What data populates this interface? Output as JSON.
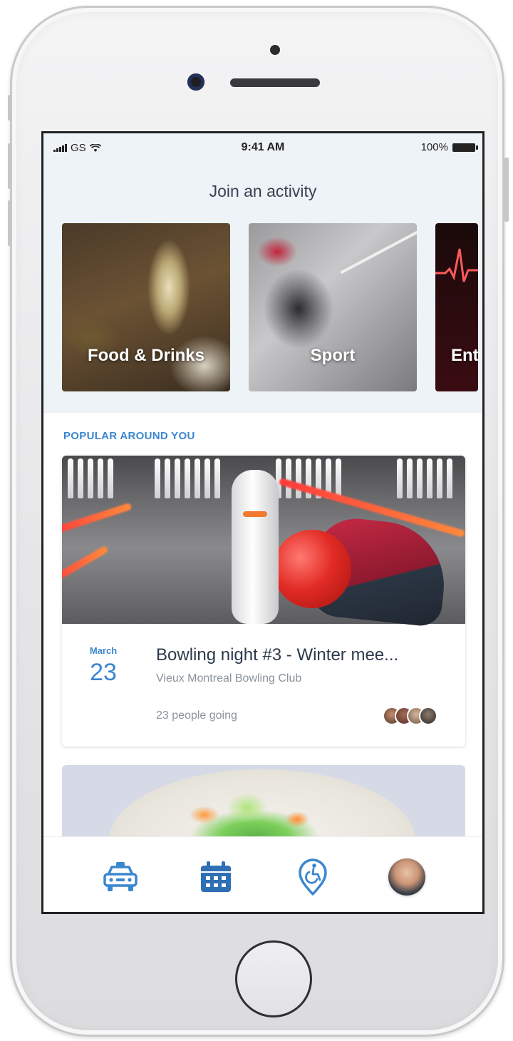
{
  "status_bar": {
    "carrier": "GS",
    "time": "9:41 AM",
    "battery": "100%"
  },
  "header": {
    "title": "Join an activity"
  },
  "categories": [
    {
      "label": "Food & Drinks"
    },
    {
      "label": "Sport"
    },
    {
      "label": "Ent"
    }
  ],
  "popular": {
    "section_title": "POPULAR AROUND YOU",
    "event": {
      "month": "March",
      "day": "23",
      "title": "Bowling night #3 - Winter mee...",
      "venue": "Vieux Montreal Bowling Club",
      "going": "23 people going"
    }
  },
  "tab_bar": {
    "items": [
      {
        "icon": "taxi-icon"
      },
      {
        "icon": "calendar-icon"
      },
      {
        "icon": "accessible-location-icon"
      },
      {
        "icon": "profile-avatar"
      }
    ]
  },
  "colors": {
    "accent": "#3b86d0",
    "top_background": "#eef3f7",
    "text_dark": "#2c3a4a",
    "text_muted": "#8a939c"
  }
}
